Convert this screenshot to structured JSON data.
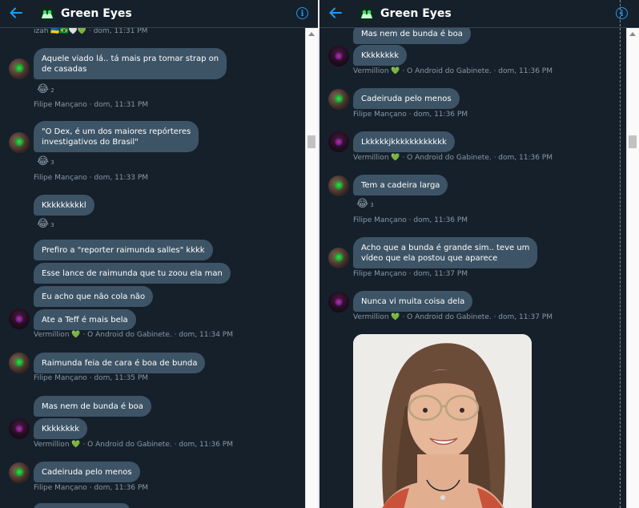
{
  "app": {
    "title": "Green Eyes",
    "accent_color": "#1d9bf0",
    "bubble_color": "#3d5466",
    "background_color": "#15202b",
    "icons": [
      "back-arrow-icon",
      "group-logo-icon",
      "info-icon"
    ]
  },
  "left": {
    "top_meta": "izah 🇺🇦🇧🇷🤍💚 · dom, 11:31 PM",
    "messages": [
      {
        "line1": "Aquele viado lá.. tá mais pra tomar strap on",
        "line2": "de casadas"
      },
      {
        "line1": "\"O Dex, é um dos maiores repórteres",
        "line2": "investigativos do Brasil\""
      },
      {
        "text": "Kkkkkkkkkl"
      },
      {
        "text": "Prefiro a \"reporter raimunda salles\" kkkk"
      },
      {
        "text": "Esse lance de raimunda que tu zoou ela man"
      },
      {
        "text": "Eu acho que não cola não"
      },
      {
        "text": "Ate a Teff é mais bela"
      },
      {
        "text": "Raimunda feia de cara é boa de bunda"
      },
      {
        "text": "Mas nem de bunda é boa"
      },
      {
        "text": "Kkkkkkkk"
      },
      {
        "text": "Cadeiruda pelo menos"
      }
    ],
    "reactions": [
      {
        "emoji": "😂",
        "count": "2"
      },
      {
        "emoji": "😂",
        "count": "3"
      },
      {
        "emoji": "😂",
        "count": "3"
      }
    ],
    "metas": [
      "Filipe Mançano · dom, 11:31 PM",
      "Filipe Mançano · dom, 11:33 PM",
      "Vermillion 💚 · O Android do Gabinete. · dom, 11:34 PM",
      "Filipe Mançano · dom, 11:35 PM",
      "Vermillion 💚 · O Android do Gabinete. · dom, 11:36 PM",
      "Filipe Mançano · dom, 11:36 PM"
    ]
  },
  "right": {
    "messages": [
      {
        "text": "Mas nem de bunda é boa"
      },
      {
        "text": "Kkkkkkkk"
      },
      {
        "text": "Cadeiruda pelo menos"
      },
      {
        "text": "Lkkkkkjkkkkkkkkkkkk"
      },
      {
        "text": "Tem a cadeira larga"
      },
      {
        "line1": "Acho que a bunda é grande sim.. teve um",
        "line2": "vídeo que ela postou que aparece"
      },
      {
        "text": "Nunca vi muita coisa dela"
      }
    ],
    "reactions": [
      {
        "emoji": "😂",
        "count": "3"
      }
    ],
    "metas": [
      "Vermillion 💚 · O Android do Gabinete. · dom, 11:36 PM",
      "Filipe Mançano · dom, 11:36 PM",
      "Vermillion 💚 · O Android do Gabinete. · dom, 11:36 PM",
      "Filipe Mançano · dom, 11:36 PM",
      "Filipe Mançano · dom, 11:37 PM",
      "Vermillion 💚 · O Android do Gabinete. · dom, 11:37 PM"
    ]
  }
}
